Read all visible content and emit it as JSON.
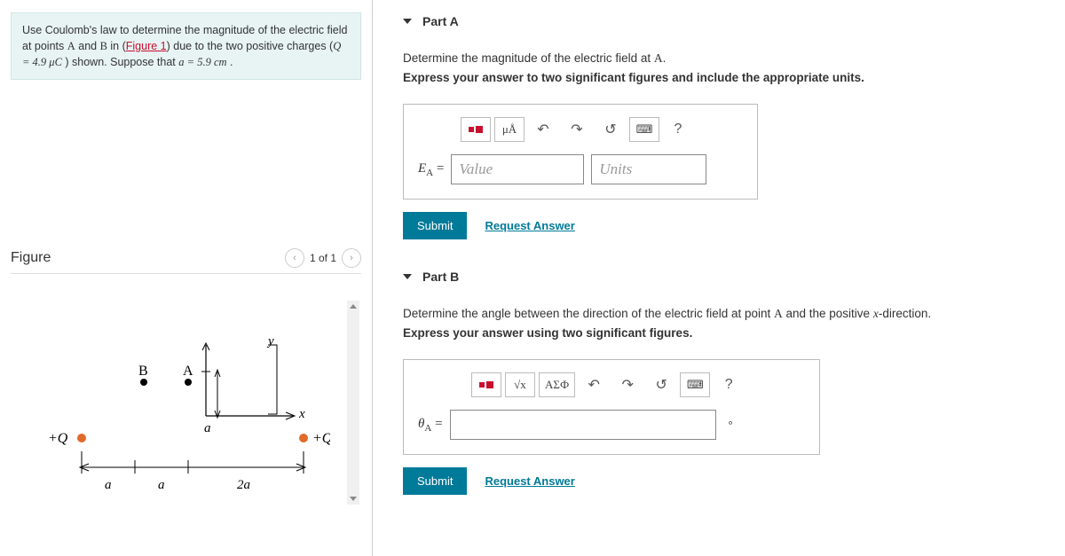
{
  "problem": {
    "text_1": "Use Coulomb's law to determine the magnitude of the electric field at points ",
    "pointA": "A",
    "and": " and ",
    "pointB": "B",
    "in": " in (",
    "figure_link": "Figure 1",
    "text_2": ") due to the two positive charges (",
    "Qeq": "Q = 4.9 μC",
    "text_3": " ) shown. Suppose that ",
    "aeq": "a = 5.9 cm",
    "dot": " ."
  },
  "figure": {
    "title": "Figure",
    "pager": "1 of 1",
    "labels": {
      "B": "B",
      "A": "A",
      "y": "y",
      "x": "x",
      "aTop": "a",
      "plusQL": "+Q",
      "plusQR": "+Q",
      "a1": "a",
      "a2": "a",
      "two_a": "2a"
    }
  },
  "partA": {
    "title": "Part A",
    "prompt_pre": "Determine the magnitude of the electric field at ",
    "prompt_A": "A",
    "prompt_post": ".",
    "instruct": "Express your answer to two significant figures and include the appropriate units.",
    "toolbar": {
      "mu": "μÅ",
      "help": "?"
    },
    "label": "E",
    "sub": "A",
    "eq": " =",
    "value_ph": "Value",
    "units_ph": "Units",
    "submit": "Submit",
    "request": "Request Answer"
  },
  "partB": {
    "title": "Part B",
    "prompt_pre": "Determine the angle between the direction of the electric field at point ",
    "prompt_A": "A",
    "prompt_mid": " and the positive ",
    "prompt_x": "x",
    "prompt_post": "-direction.",
    "instruct": "Express your answer using two significant figures.",
    "toolbar": {
      "greek": "ΑΣФ",
      "help": "?"
    },
    "label": "θ",
    "sub": "A",
    "eq": " =",
    "degree": "°",
    "submit": "Submit",
    "request": "Request Answer"
  }
}
